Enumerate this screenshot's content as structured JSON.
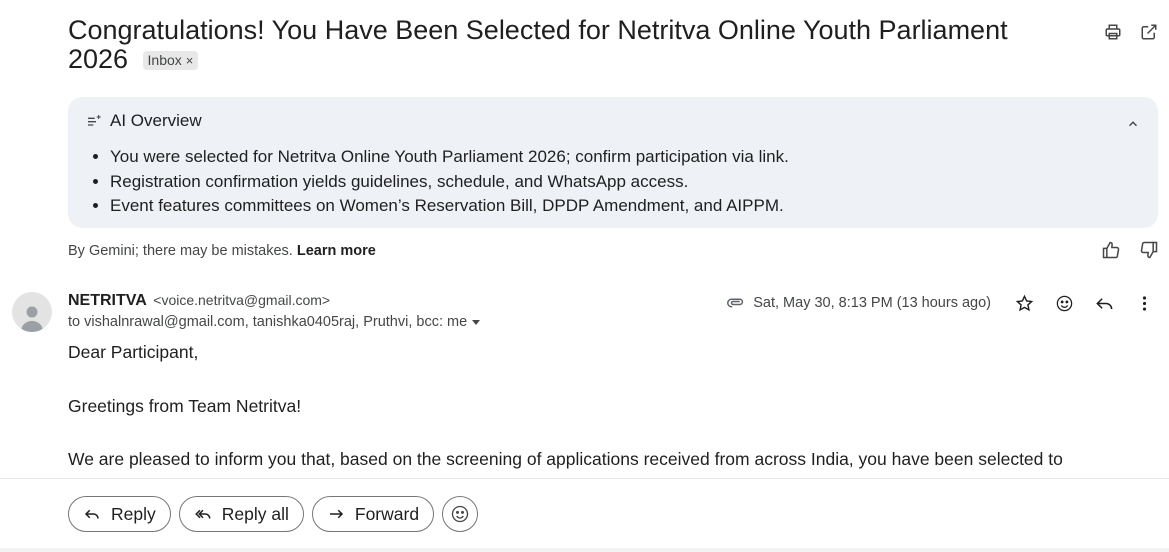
{
  "email": {
    "subject": "Congratulations! You Have Been Selected for Netritva Online Youth Parliament 2026",
    "label_chip": "Inbox",
    "label_chip_remove": "×"
  },
  "ai_overview": {
    "title": "AI Overview",
    "bullets": [
      "You were selected for Netritva Online Youth Parliament 2026; confirm participation via link.",
      "Registration confirmation yields guidelines, schedule, and WhatsApp access.",
      "Event features committees on Women’s Reservation Bill, DPDP Amendment, and AIPPM."
    ],
    "disclaimer": "By Gemini; there may be mistakes.",
    "learn_more": "Learn more"
  },
  "message": {
    "sender_name": "NETRITVA",
    "sender_email": "<voice.netritva@gmail.com>",
    "recipients": "to vishalnrawal@gmail.com, tanishka0405raj, Pruthvi, bcc: me",
    "date": "Sat, May 30, 8:13 PM (13 hours ago)",
    "body": [
      "Dear Participant,",
      "Greetings from Team Netritva!",
      "We are pleased to inform you that, based on the screening of applications received from across India, you have been selected to"
    ]
  },
  "footer": {
    "reply_label": "Reply",
    "reply_all_label": "Reply all",
    "forward_label": "Forward"
  },
  "icons": {
    "print": "print-icon",
    "open_new_window": "open-in-new-window-icon",
    "ai_overview": "sparkle-list-icon",
    "collapse": "chevron-up-icon",
    "thumbs_up": "thumbs-up-icon",
    "thumbs_down": "thumbs-down-icon",
    "attachment": "paperclip-icon",
    "star": "star-icon",
    "emoji": "add-reaction-icon",
    "reply": "reply-icon",
    "more": "more-vert-icon",
    "reply_all": "reply-all-icon",
    "forward": "forward-icon"
  },
  "colors": {
    "ai_panel_bg": "#eef2f7",
    "text_primary": "#1f1f1f",
    "text_secondary": "#444746",
    "chip_bg": "#e8e8e8",
    "button_border": "#747775"
  }
}
